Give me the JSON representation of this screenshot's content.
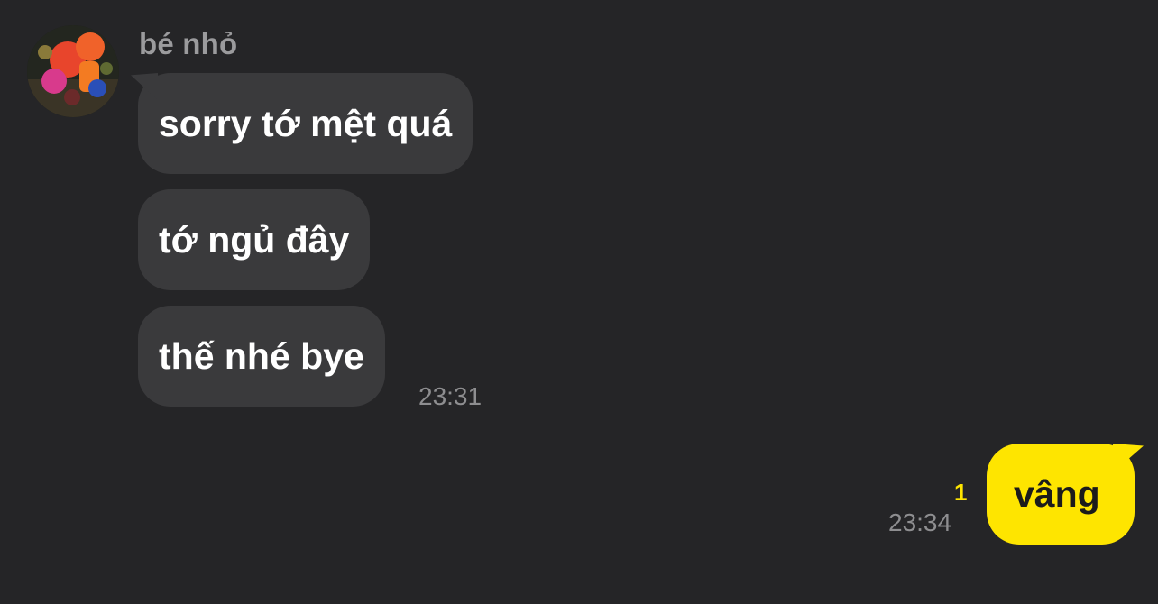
{
  "conversation": {
    "contact_name": "bé nhỏ",
    "incoming": [
      {
        "text": "sorry tớ mệt quá"
      },
      {
        "text": "tớ ngủ đây"
      },
      {
        "text": "thế nhé bye"
      }
    ],
    "incoming_time": "23:31",
    "outgoing": {
      "text": "vâng",
      "time": "23:34",
      "unread_count": "1"
    }
  },
  "colors": {
    "background": "#252527",
    "incoming_bubble": "#3a3a3c",
    "outgoing_bubble": "#fee500",
    "timestamp": "#8e8e90",
    "unread": "#fee500"
  }
}
